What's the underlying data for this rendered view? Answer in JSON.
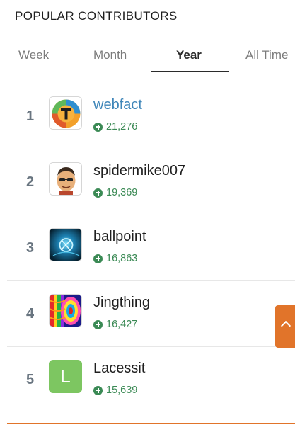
{
  "header": {
    "title": "POPULAR CONTRIBUTORS"
  },
  "tabs": [
    {
      "label": "Week",
      "active": false
    },
    {
      "label": "Month",
      "active": false
    },
    {
      "label": "Year",
      "active": true
    },
    {
      "label": "All Time",
      "active": false
    }
  ],
  "contributors": [
    {
      "rank": "1",
      "name": "webfact",
      "points": "21,276",
      "avatar": "webfact-logo-avatar",
      "is_link": true
    },
    {
      "rank": "2",
      "name": "spidermike007",
      "points": "19,369",
      "avatar": "cartoon-face-avatar"
    },
    {
      "rank": "3",
      "name": "ballpoint",
      "points": "16,863",
      "avatar": "blue-glow-avatar"
    },
    {
      "rank": "4",
      "name": "Jingthing",
      "points": "16,427",
      "avatar": "psychedelic-pattern-avatar"
    },
    {
      "rank": "5",
      "name": "Lacessit",
      "points": "15,639",
      "avatar": "letter-avatar",
      "avatar_letter": "L"
    }
  ],
  "colors": {
    "accent_orange": "#e1742a",
    "points_green": "#3b8a55",
    "link_blue": "#3f86b9",
    "rank_gray": "#697580",
    "letter_avatar_green": "#7dc661"
  },
  "icons": {
    "points": "plus-circle-icon",
    "side_tab": "chevron-up-icon"
  }
}
